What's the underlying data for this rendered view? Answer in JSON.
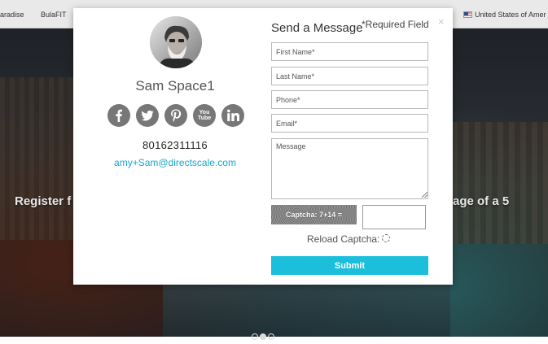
{
  "topbar": {
    "items": [
      "aradise",
      "BulaFIT"
    ],
    "country": "United States of Amer"
  },
  "banner": {
    "left_text": "Register f",
    "right_text": "age of a 5"
  },
  "carousel": {
    "slides": 3,
    "active_index": 1
  },
  "modal": {
    "close_label": "×",
    "profile": {
      "name": "Sam Space1",
      "phone": "80162311116",
      "email": "amy+Sam@directscale.com",
      "socials": [
        "facebook-icon",
        "twitter-icon",
        "pinterest-icon",
        "youtube-icon",
        "linkedin-icon"
      ],
      "youtube_label": "You Tube"
    },
    "form": {
      "title": "Send a Message",
      "required_note": "*Required Field",
      "first_name_placeholder": "First Name*",
      "last_name_placeholder": "Last Name*",
      "phone_placeholder": "Phone*",
      "email_placeholder": "Email*",
      "message_placeholder": "Message",
      "captcha_text": "Captcha: 7+14 =",
      "reload_label": "Reload Captcha:",
      "submit_label": "Submit"
    }
  },
  "colors": {
    "accent": "#1bbfdc",
    "link": "#17a7cc",
    "social_bg": "#777777"
  }
}
